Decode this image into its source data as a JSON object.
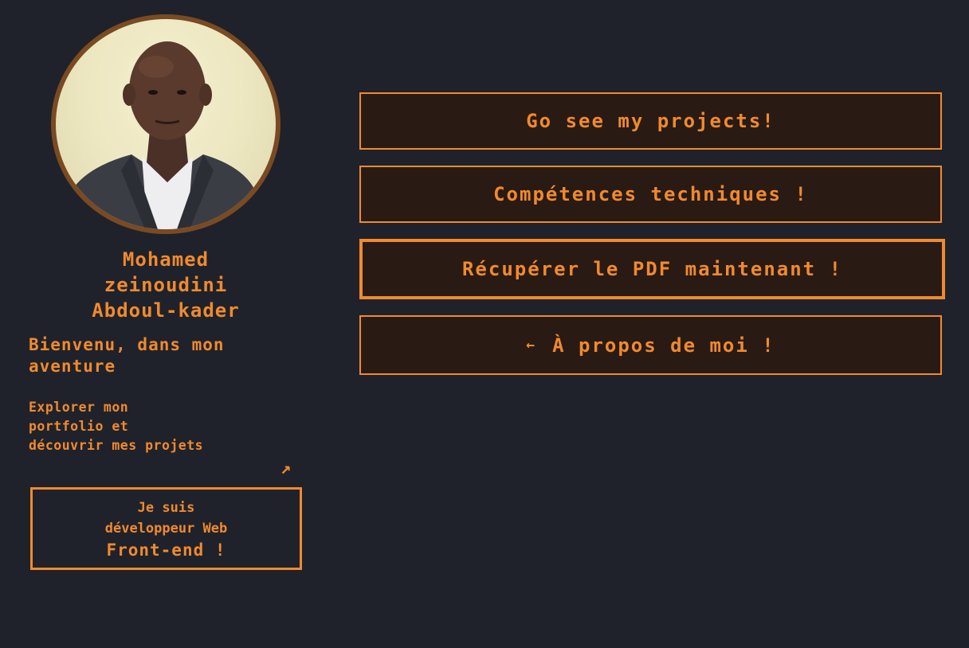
{
  "profile": {
    "name_line1": "Mohamed",
    "name_line2": "zeinoudini",
    "name_line3": "Abdoul-kader",
    "welcome": "Bienvenu, dans mon aventure",
    "explore_line1": "Explorer mon",
    "explore_line2": "portfolio et",
    "explore_line3": "découvrir mes projets",
    "explore_arrow": "↗",
    "role_line1": "Je suis",
    "role_line2": "développeur Web",
    "role_line3": "Front-end !"
  },
  "buttons": {
    "projects": "Go see my projects!",
    "skills": "Compétences techniques !",
    "pdf": "Récupérer le PDF maintenant !",
    "about_arrow": "←",
    "about": "À propos de moi !"
  },
  "colors": {
    "background": "#1f222a",
    "accent": "#f08a2e",
    "button_bg": "#2a1a14",
    "avatar_border": "#7a4a22"
  }
}
